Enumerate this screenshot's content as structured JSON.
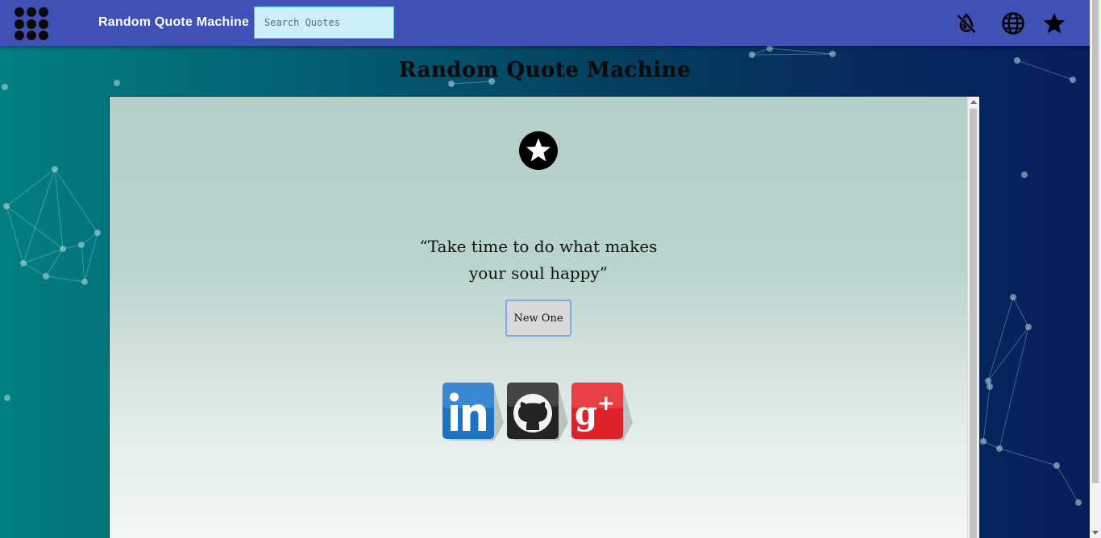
{
  "header": {
    "app_title": "Random Quote Machine",
    "search_placeholder": "Search Quotes"
  },
  "page": {
    "heading": "Random Quote Machine"
  },
  "quote_card": {
    "quote_text": "“Take time to do what makes your soul happy”",
    "new_button_label": "New One"
  },
  "icons": {
    "menu": "app-grid-icon",
    "toggle": "invert-colors-off-icon",
    "language": "globe-icon",
    "favorite": "star-icon",
    "badge": "star-circle-icon",
    "social": [
      "linkedin-icon",
      "github-icon",
      "google-plus-icon"
    ]
  },
  "colors": {
    "topbar": "#3f51b5",
    "search_bg": "#cdeefb",
    "search_border": "#52c1ea",
    "button_border": "#7ea7e6",
    "linkedin": "#1e72c4",
    "github": "#2a2a2a",
    "google_plus": "#e0222a"
  }
}
